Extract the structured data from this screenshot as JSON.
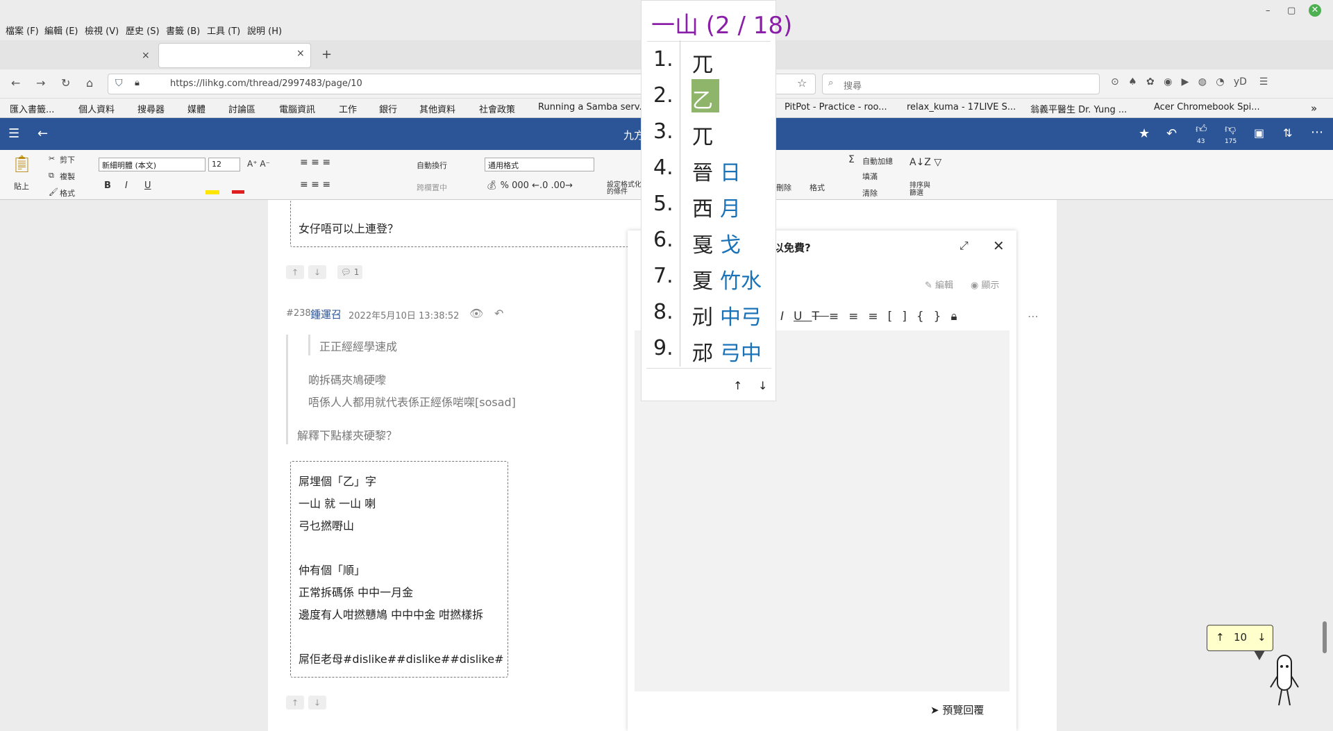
{
  "menu": [
    "檔案 (F)",
    "編輯 (E)",
    "檢視 (V)",
    "歷史 (S)",
    "書籤 (B)",
    "工具 (T)",
    "說明 (H)"
  ],
  "window_controls": [
    "–",
    "▢",
    "✕"
  ],
  "tabs": {
    "close1": "×",
    "close2": "×",
    "new_tab": "+"
  },
  "nav": {
    "url": "https://lihkg.com/thread/2997483/page/10",
    "search_placeholder": "搜尋"
  },
  "bookmarks": [
    "匯入書籤...",
    "個人資料",
    "搜尋器",
    "媒體",
    "討論區",
    "電腦資訊",
    "工作",
    "銀行",
    "其他資料",
    "社會政策",
    "Running a Samba serv...",
    "PitPot - Practice - roo...",
    "relax_kuma - 17LIVE S...",
    "翁義平醫生 Dr. Yung ...",
    "Acer Chromebook Spi..."
  ],
  "lihkg": {
    "title": "九方",
    "like_count": "43",
    "dislike_count": "175"
  },
  "excel": {
    "paste": "貼上",
    "cut": "剪下",
    "copy": "複製",
    "format_painter": "格式",
    "font": "新細明體 (本文)",
    "size": "12",
    "wrap": "自動換行",
    "merge": "跨欄置中",
    "number_format": "通用格式",
    "cond_format": "設定格式化的條件",
    "delete": "刪除",
    "format": "格式",
    "autosum": "自動加總",
    "fill": "填滿",
    "clear": "清除",
    "sort": "排序與篩選"
  },
  "post_prev": {
    "text": "女仔唔可以上連登？",
    "reply_count": "1"
  },
  "post238": {
    "num": "#238",
    "author": "鍾運召",
    "date": "2022年5月10日 13:38:52",
    "quote_inner": "正正經經學速成",
    "quote_lines": [
      "啲拆碼夾鳩硬嚟",
      "唔係人人都用就代表係正經係啱㗎[sosad]"
    ],
    "question": "解釋下點樣夾硬黎？",
    "body": [
      "屌埋個「乙」字",
      "一山 就 一山 喇",
      "弓乜撚嘢山",
      "",
      "仲有個「順」",
      "正常拆碼係 中中一月金",
      "邊度有人咁撚戇鳩 中中中金 咁撚樣拆",
      "",
      "屌佢老母#dislike##dislike##dislike#"
    ]
  },
  "reply": {
    "title_partial": "以免費?",
    "edit": "編輯",
    "show": "顯示",
    "preview": "預覽回覆"
  },
  "ime": {
    "header": "一山 (2 / 18)",
    "candidates": [
      {
        "n": "1.",
        "c": "兀",
        "r": ""
      },
      {
        "n": "2.",
        "c": "乙",
        "r": ""
      },
      {
        "n": "3.",
        "c": "兀",
        "r": ""
      },
      {
        "n": "4.",
        "c": "晉",
        "r": "日"
      },
      {
        "n": "5.",
        "c": "西",
        "r": "月"
      },
      {
        "n": "6.",
        "c": "戛",
        "r": "戈"
      },
      {
        "n": "7.",
        "c": "夏",
        "r": "竹水"
      },
      {
        "n": "8.",
        "c": "刓",
        "r": "中弓"
      },
      {
        "n": "9.",
        "c": "邧",
        "r": "弓中"
      }
    ],
    "up": "↑",
    "down": "↓"
  },
  "pager": {
    "page": "10",
    "up": "↑",
    "down": "↓"
  },
  "colors": {
    "lihkg_bar": "#2c5597",
    "ime_header": "#8a1ea8",
    "ime_radical": "#1a73b8",
    "ime_selected": "#8fb56a"
  }
}
